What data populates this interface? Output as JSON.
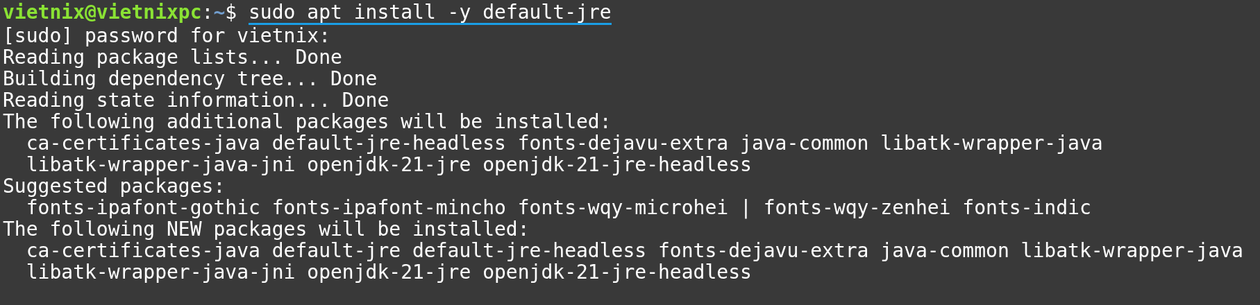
{
  "prompt": {
    "user_host": "vietnix@vietnixpc",
    "separator": ":",
    "path": "~",
    "symbol": "$"
  },
  "command": {
    "text": "sudo apt install -y default-jre",
    "underlined": true
  },
  "output_lines": [
    "[sudo] password for vietnix:",
    "Reading package lists... Done",
    "Building dependency tree... Done",
    "Reading state information... Done",
    "The following additional packages will be installed:",
    "  ca-certificates-java default-jre-headless fonts-dejavu-extra java-common libatk-wrapper-java",
    "  libatk-wrapper-java-jni openjdk-21-jre openjdk-21-jre-headless",
    "Suggested packages:",
    "  fonts-ipafont-gothic fonts-ipafont-mincho fonts-wqy-microhei | fonts-wqy-zenhei fonts-indic",
    "The following NEW packages will be installed:",
    "  ca-certificates-java default-jre default-jre-headless fonts-dejavu-extra java-common libatk-wrapper-java",
    "  libatk-wrapper-java-jni openjdk-21-jre openjdk-21-jre-headless"
  ]
}
